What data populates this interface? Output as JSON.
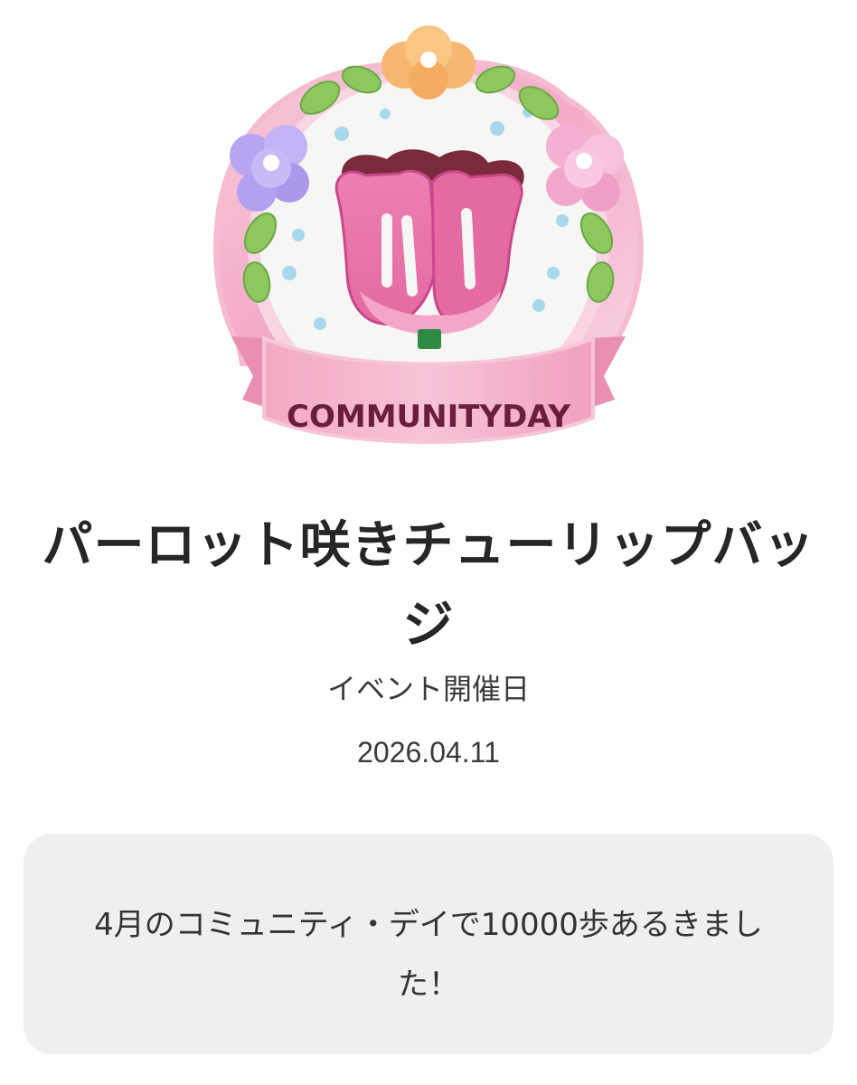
{
  "badge": {
    "ribbon_text": "COMMUNITYDAY",
    "colors": {
      "pink_frame": "#f2b6cc",
      "ribbon": "#f1a3c0",
      "ribbon_text": "#6b1d3e",
      "tulip_pink": "#e56aa2",
      "tulip_dark": "#7a2a3a",
      "leaf_green": "#8cc85e",
      "orange_flower": "#f7b772",
      "purple_flower": "#b9a6f3",
      "pink_flower": "#f4b0d3",
      "dot_blue": "#a8d8ec"
    }
  },
  "title": "パーロット咲きチューリップバッジ",
  "event": {
    "label": "イベント開催日",
    "date": "2026.04.11"
  },
  "description": "4月のコミュニティ・デイで10000歩あるきました！"
}
